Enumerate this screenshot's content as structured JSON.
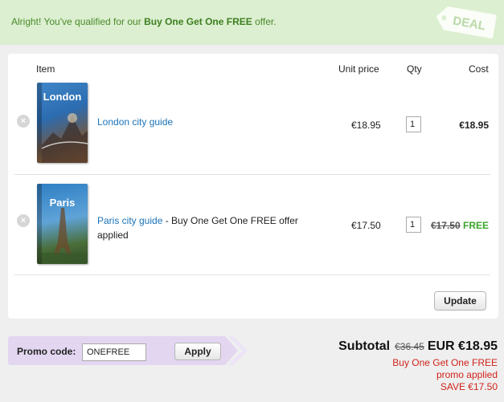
{
  "banner": {
    "prefix": "Alright! You've qualified for our ",
    "offer": "Buy One Get One FREE",
    "suffix": " offer.",
    "tag": "DEAL"
  },
  "cart": {
    "headers": {
      "item": "Item",
      "unit_price": "Unit price",
      "qty": "Qty",
      "cost": "Cost"
    },
    "items": [
      {
        "name": "London city guide",
        "note": "",
        "cover_title": "London",
        "unit_price": "€18.95",
        "qty": "1",
        "cost": "€18.95",
        "cover_color": "#2c6cb0"
      },
      {
        "name": "Paris city guide",
        "note": " - Buy One Get One FREE offer applied",
        "cover_title": "Paris",
        "unit_price": "€17.50",
        "qty": "1",
        "cost_original": "€17.50",
        "cost_label": "FREE",
        "cover_color": "#2f7fc4"
      }
    ],
    "update_label": "Update"
  },
  "promo": {
    "label": "Promo code:",
    "value": "ONEFREE",
    "apply_label": "Apply"
  },
  "summary": {
    "label": "Subtotal",
    "original": "€36.45",
    "total": "EUR €18.95",
    "note_line1": "Buy One Get One FREE",
    "note_line2": "promo applied",
    "note_line3": "SAVE €17.50"
  },
  "colors": {
    "banner_bg": "#dcefd0",
    "banner_text": "#4a8a2a",
    "link": "#1a73b8",
    "free": "#3aa52a",
    "promo_bg": "#e3d6f1",
    "savings": "#d0231b"
  }
}
